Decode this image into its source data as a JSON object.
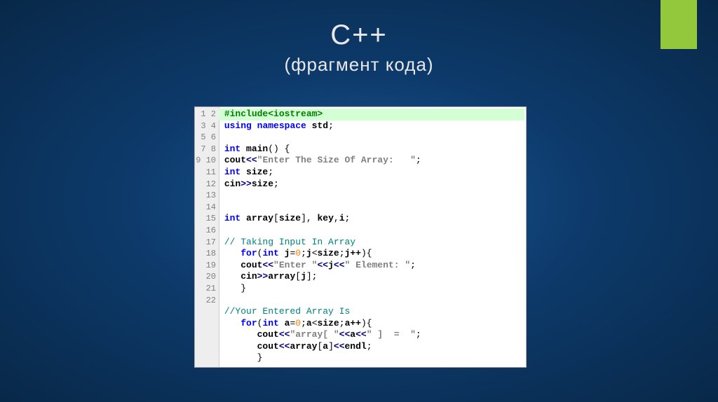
{
  "title": {
    "line1": "C++",
    "line2": "(фрагмент кода)"
  },
  "gutter": [
    "1",
    "2",
    "3",
    "4",
    "5",
    "6",
    "7",
    "8",
    "9",
    "10",
    "11",
    "12",
    "13",
    "14",
    "15",
    "16",
    "17",
    "18",
    "19",
    "20",
    "21",
    "22"
  ],
  "code": {
    "l1_pre": "#include<iostream>",
    "l2_kw1": "using",
    "l2_kw2": "namespace",
    "l2_id": "std",
    "l4_ty": "int",
    "l4_fn": "main",
    "l5_id": "cout",
    "l5_op": "<<",
    "l5_str": "\"Enter The Size Of Array:   \"",
    "l6_ty": "int",
    "l6_id": "size",
    "l7_id": "cin",
    "l7_op": ">>",
    "l7_v": "size",
    "l10_ty": "int",
    "l10_id1": "array",
    "l10_id2": "size",
    "l10_id3": "key",
    "l10_id4": "i",
    "l12_cm": "// Taking Input In Array",
    "l13_kw": "for",
    "l13_ty": "int",
    "l13_id": "j",
    "l13_z": "0",
    "l13_sz": "size",
    "l13_jpp": "j++",
    "l14_id": "cout",
    "l14_op": "<<",
    "l14_s1": "\"Enter \"",
    "l14_j": "j",
    "l14_s2": "\" Element: \"",
    "l15_id": "cin",
    "l15_op": ">>",
    "l15_arr": "array",
    "l15_j": "j",
    "l18_cm": "//Your Entered Array Is",
    "l19_kw": "for",
    "l19_ty": "int",
    "l19_id": "a",
    "l19_z": "0",
    "l19_sz": "size",
    "l19_app": "a++",
    "l20_id": "cout",
    "l20_op": "<<",
    "l20_s1": "\"array[ \"",
    "l20_a": "a",
    "l20_s2": "\" ]  =  \"",
    "l21_id": "cout",
    "l21_op": "<<",
    "l21_arr": "array",
    "l21_a": "a",
    "l21_endl": "endl"
  }
}
